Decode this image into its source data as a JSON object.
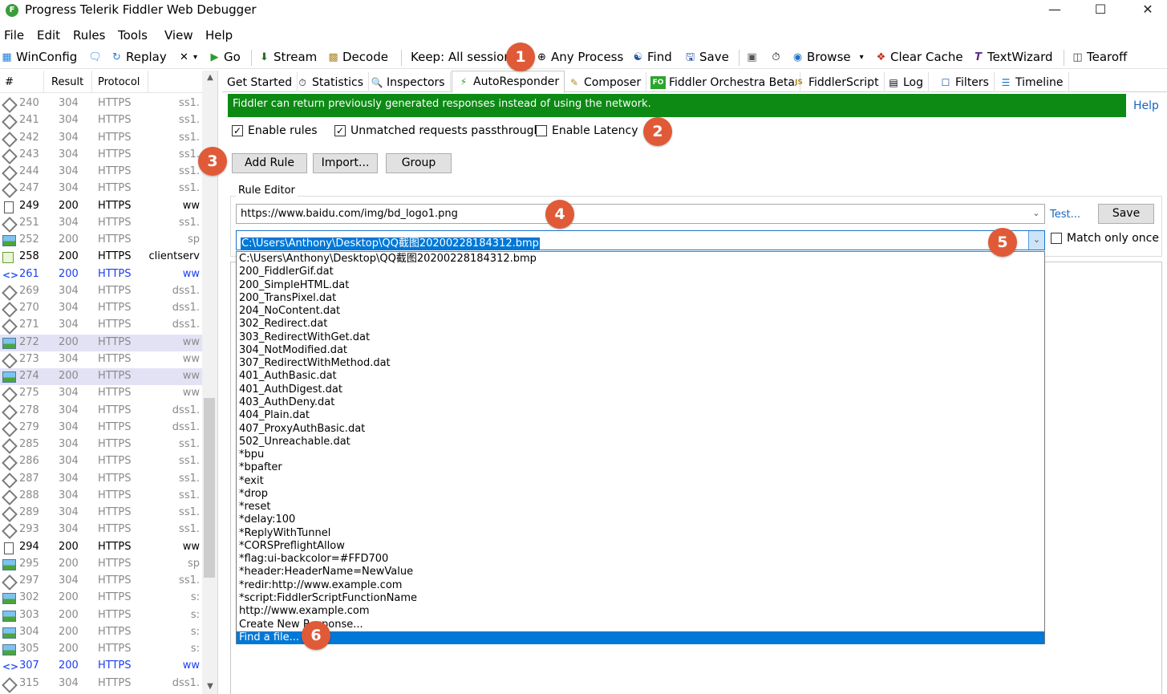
{
  "window": {
    "title": "Progress Telerik Fiddler Web Debugger",
    "app_icon_letter": "F"
  },
  "menu": [
    "File",
    "Edit",
    "Rules",
    "Tools",
    "View",
    "Help"
  ],
  "toolbar": {
    "winconfig": "WinConfig",
    "replay": "Replay",
    "go": "Go",
    "stream": "Stream",
    "decode": "Decode",
    "keep": "Keep: All sessions",
    "any_process": "Any Process",
    "find": "Find",
    "save": "Save",
    "browse": "Browse",
    "clear_cache": "Clear Cache",
    "textwizard": "TextWizard",
    "tearoff": "Tearoff"
  },
  "sessions": {
    "headers": [
      "#",
      "Result",
      "Protocol"
    ],
    "rows": [
      {
        "id": "240",
        "result": "304",
        "protocol": "HTTPS",
        "host": "ss1.",
        "icon": "diamond",
        "style": ""
      },
      {
        "id": "241",
        "result": "304",
        "protocol": "HTTPS",
        "host": "ss1.",
        "icon": "diamond",
        "style": ""
      },
      {
        "id": "242",
        "result": "304",
        "protocol": "HTTPS",
        "host": "ss1.",
        "icon": "diamond",
        "style": ""
      },
      {
        "id": "243",
        "result": "304",
        "protocol": "HTTPS",
        "host": "ss1.",
        "icon": "diamond",
        "style": ""
      },
      {
        "id": "244",
        "result": "304",
        "protocol": "HTTPS",
        "host": "ss1.",
        "icon": "diamond",
        "style": ""
      },
      {
        "id": "247",
        "result": "304",
        "protocol": "HTTPS",
        "host": "ss1.",
        "icon": "diamond",
        "style": ""
      },
      {
        "id": "249",
        "result": "200",
        "protocol": "HTTPS",
        "host": "ww",
        "icon": "doc",
        "style": "bold"
      },
      {
        "id": "251",
        "result": "304",
        "protocol": "HTTPS",
        "host": "ss1.",
        "icon": "diamond",
        "style": ""
      },
      {
        "id": "252",
        "result": "200",
        "protocol": "HTTPS",
        "host": "sp",
        "icon": "img",
        "style": ""
      },
      {
        "id": "258",
        "result": "200",
        "protocol": "HTTPS",
        "host": "clientserv",
        "icon": "green",
        "style": "bold"
      },
      {
        "id": "261",
        "result": "200",
        "protocol": "HTTPS",
        "host": "ww",
        "icon": "arrows",
        "style": "blue"
      },
      {
        "id": "269",
        "result": "304",
        "protocol": "HTTPS",
        "host": "dss1.",
        "icon": "diamond",
        "style": ""
      },
      {
        "id": "270",
        "result": "304",
        "protocol": "HTTPS",
        "host": "dss1.",
        "icon": "diamond",
        "style": ""
      },
      {
        "id": "271",
        "result": "304",
        "protocol": "HTTPS",
        "host": "dss1.",
        "icon": "diamond",
        "style": ""
      },
      {
        "id": "272",
        "result": "200",
        "protocol": "HTTPS",
        "host": "ww",
        "icon": "img",
        "style": "hl"
      },
      {
        "id": "273",
        "result": "304",
        "protocol": "HTTPS",
        "host": "ww",
        "icon": "diamond",
        "style": ""
      },
      {
        "id": "274",
        "result": "200",
        "protocol": "HTTPS",
        "host": "ww",
        "icon": "img",
        "style": "hl"
      },
      {
        "id": "275",
        "result": "304",
        "protocol": "HTTPS",
        "host": "ww",
        "icon": "diamond",
        "style": ""
      },
      {
        "id": "278",
        "result": "304",
        "protocol": "HTTPS",
        "host": "dss1.",
        "icon": "diamond",
        "style": ""
      },
      {
        "id": "279",
        "result": "304",
        "protocol": "HTTPS",
        "host": "dss1.",
        "icon": "diamond",
        "style": ""
      },
      {
        "id": "285",
        "result": "304",
        "protocol": "HTTPS",
        "host": "ss1.",
        "icon": "diamond",
        "style": ""
      },
      {
        "id": "286",
        "result": "304",
        "protocol": "HTTPS",
        "host": "ss1.",
        "icon": "diamond",
        "style": ""
      },
      {
        "id": "287",
        "result": "304",
        "protocol": "HTTPS",
        "host": "ss1.",
        "icon": "diamond",
        "style": ""
      },
      {
        "id": "288",
        "result": "304",
        "protocol": "HTTPS",
        "host": "ss1.",
        "icon": "diamond",
        "style": ""
      },
      {
        "id": "289",
        "result": "304",
        "protocol": "HTTPS",
        "host": "ss1.",
        "icon": "diamond",
        "style": ""
      },
      {
        "id": "293",
        "result": "304",
        "protocol": "HTTPS",
        "host": "ss1.",
        "icon": "diamond",
        "style": ""
      },
      {
        "id": "294",
        "result": "200",
        "protocol": "HTTPS",
        "host": "ww",
        "icon": "doc",
        "style": "bold"
      },
      {
        "id": "295",
        "result": "200",
        "protocol": "HTTPS",
        "host": "sp",
        "icon": "img",
        "style": ""
      },
      {
        "id": "297",
        "result": "304",
        "protocol": "HTTPS",
        "host": "ss1.",
        "icon": "diamond",
        "style": ""
      },
      {
        "id": "302",
        "result": "200",
        "protocol": "HTTPS",
        "host": "s:",
        "icon": "img",
        "style": ""
      },
      {
        "id": "303",
        "result": "200",
        "protocol": "HTTPS",
        "host": "s:",
        "icon": "img",
        "style": ""
      },
      {
        "id": "304",
        "result": "200",
        "protocol": "HTTPS",
        "host": "s:",
        "icon": "img",
        "style": ""
      },
      {
        "id": "305",
        "result": "200",
        "protocol": "HTTPS",
        "host": "s:",
        "icon": "img",
        "style": ""
      },
      {
        "id": "307",
        "result": "200",
        "protocol": "HTTPS",
        "host": "ww",
        "icon": "arrows",
        "style": "blue"
      },
      {
        "id": "315",
        "result": "304",
        "protocol": "HTTPS",
        "host": "dss1.",
        "icon": "diamond",
        "style": ""
      }
    ]
  },
  "tabs": [
    {
      "label": "Get Started",
      "icon": ""
    },
    {
      "label": "Statistics",
      "icon": "stopwatch-icon"
    },
    {
      "label": "Inspectors",
      "icon": "inspect-icon"
    },
    {
      "label": "AutoResponder",
      "icon": "lightning-icon"
    },
    {
      "label": "Composer",
      "icon": "pencil-icon"
    },
    {
      "label": "Fiddler Orchestra Beta",
      "icon": "fo-icon"
    },
    {
      "label": "FiddlerScript",
      "icon": "js-icon"
    },
    {
      "label": "Log",
      "icon": "log-icon"
    },
    {
      "label": "Filters",
      "icon": "checkbox-icon"
    },
    {
      "label": "Timeline",
      "icon": "timeline-icon"
    }
  ],
  "autoresponder": {
    "banner": "Fiddler can return previously generated responses instead of using the network.",
    "help": "Help",
    "enable_rules": "Enable rules",
    "unmatched": "Unmatched requests passthrough",
    "latency": "Enable Latency",
    "add_rule": "Add Rule",
    "import": "Import...",
    "group": "Group",
    "rule_editor": "Rule Editor",
    "match_value": "https://www.baidu.com/img/bd_logo1.png",
    "action_value": "C:\\Users\\Anthony\\Desktop\\QQ截图20200228184312.bmp",
    "test": "Test...",
    "save": "Save",
    "match_once": "Match only once",
    "action_options": [
      "C:\\Users\\Anthony\\Desktop\\QQ截图20200228184312.bmp",
      "200_FiddlerGif.dat",
      "200_SimpleHTML.dat",
      "200_TransPixel.dat",
      "204_NoContent.dat",
      "302_Redirect.dat",
      "303_RedirectWithGet.dat",
      "304_NotModified.dat",
      "307_RedirectWithMethod.dat",
      "401_AuthBasic.dat",
      "401_AuthDigest.dat",
      "403_AuthDeny.dat",
      "404_Plain.dat",
      "407_ProxyAuthBasic.dat",
      "502_Unreachable.dat",
      "*bpu",
      "*bpafter",
      "*exit",
      "*drop",
      "*reset",
      "*delay:100",
      "*ReplyWithTunnel",
      "*CORSPreflightAllow",
      "*flag:ui-backcolor=#FFD700",
      "*header:HeaderName=NewValue",
      "*redir:http://www.example.com",
      "*script:FiddlerScriptFunctionName",
      "http://www.example.com",
      "Create New Response...",
      "Find a file..."
    ]
  },
  "badges": [
    "1",
    "2",
    "3",
    "4",
    "5",
    "6"
  ],
  "colors": {
    "banner": "#0c8a14",
    "selection": "#0078d7",
    "badge": "#e05a37",
    "link": "#1565c0"
  }
}
